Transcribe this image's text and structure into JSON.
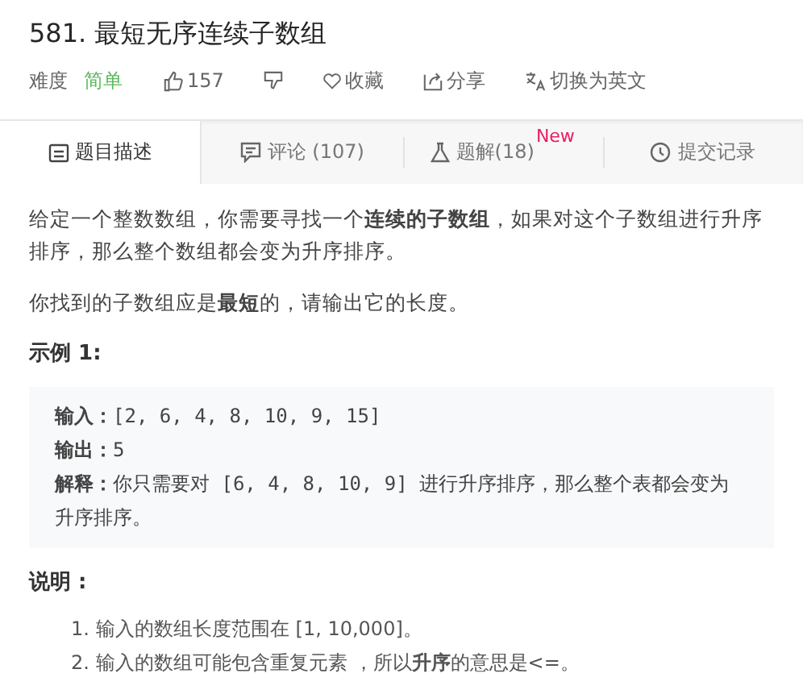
{
  "title": "581. 最短无序连续子数组",
  "meta": [
    {
      "kind": "difficulty",
      "label": "难度",
      "value": "简单"
    },
    {
      "kind": "like",
      "text": "157"
    },
    {
      "kind": "dislike"
    },
    {
      "kind": "favorite",
      "text": "收藏"
    },
    {
      "kind": "share",
      "text": "分享"
    },
    {
      "kind": "translate",
      "text": "切换为英文"
    }
  ],
  "tabs": [
    {
      "kind": "description",
      "label": "题目描述",
      "selected": true
    },
    {
      "kind": "comments",
      "label": "评论 (107)",
      "selected": false
    },
    {
      "kind": "solutions",
      "label": "题解(18)",
      "badge": "New",
      "selected": false
    },
    {
      "kind": "submissions",
      "label": "提交记录",
      "selected": false
    }
  ],
  "paragraphs": [
    "给定一个整数数组，你需要寻找一个**连续的子数组**，如果对这个子数组进行升序排序，那么整个数组都会变为升序排序。",
    "你找到的子数组应是**最短**的，请输出它的长度。"
  ],
  "example_heading": "示例 1:",
  "example_lines": [
    "**输入：**[2, 6, 4, 8, 10, 9, 15]",
    "**输出：**5",
    "**解释：**你只需要对 [6, 4, 8, 10, 9] 进行升序排序，那么整个表都会变为升序排序。"
  ],
  "notes_heading": "说明 :",
  "notes": [
    {
      "number": "1.",
      "text": "输入的数组长度范围在 [1, 10,000]。"
    },
    {
      "number": "2.",
      "text": "输入的数组可能包含重复元素 ，所以**升序**的意思是<=。"
    }
  ]
}
